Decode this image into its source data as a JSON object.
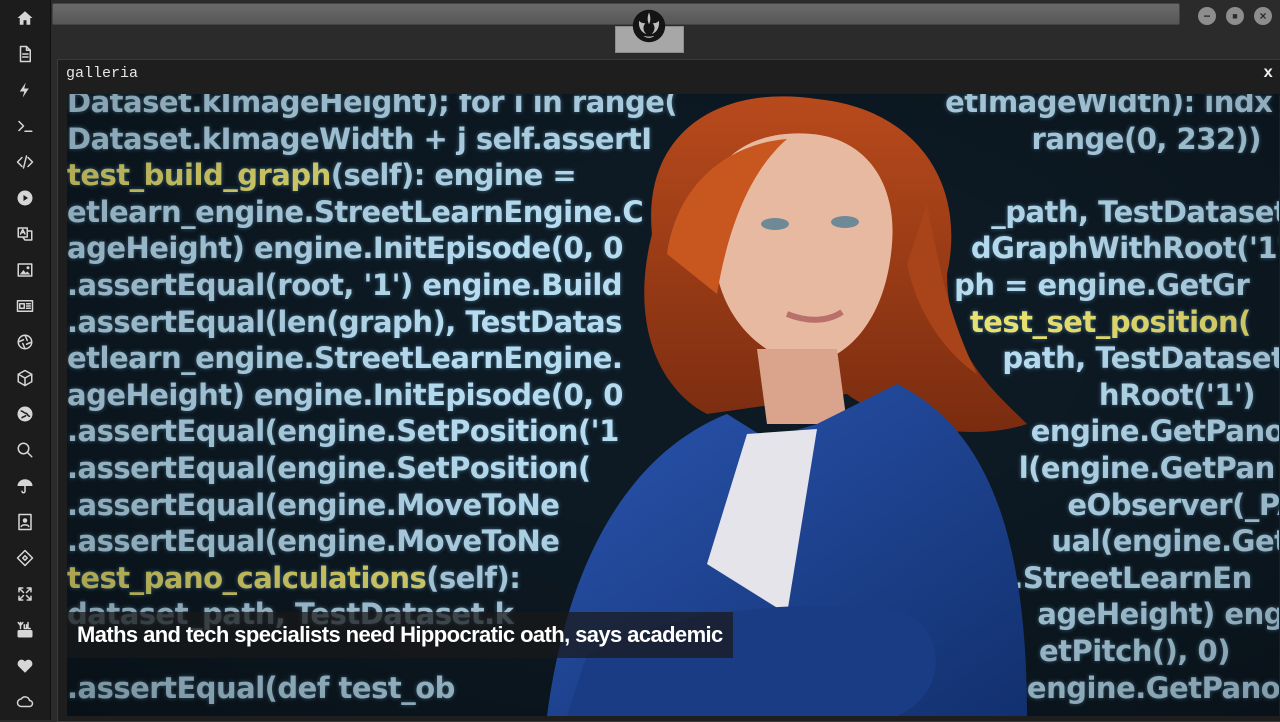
{
  "sidebar": {
    "icons": [
      "home-icon",
      "document-icon",
      "bolt-icon",
      "terminal-icon",
      "code-icon",
      "play-icon",
      "translate-icon",
      "image-icon",
      "news-icon",
      "aperture-icon",
      "hexagon-icon",
      "globe-icon",
      "search-icon",
      "umbrella-icon",
      "contact-card-icon",
      "git-diff-icon",
      "expand-icon",
      "youtube-icon",
      "heart-icon",
      "cloud-icon"
    ]
  },
  "window": {
    "logo": "rebel-alliance-logo",
    "controls": [
      "minimize",
      "maximize",
      "close"
    ]
  },
  "panel": {
    "title": "galleria",
    "close_label": "x"
  },
  "gallery": {
    "caption": "Maths and tech specialists need Hippocratic oath, says academic",
    "code_lines": [
      [
        "Dataset.kImageHeight); for i in range(",
        "",
        "etImageWidth): indx"
      ],
      [
        "Dataset.kImageWidth + j self.assertI",
        "",
        "range(0, 232))"
      ],
      [
        "test_build_graph",
        "(self): engine =",
        ""
      ],
      [
        "etlearn_engine.StreetLearnEngine.C",
        "",
        "_path, TestDataset"
      ],
      [
        "ageHeight) engine.InitEpisode(0, 0",
        "",
        "dGraphWithRoot('1'"
      ],
      [
        ".assertEqual(root, '1') engine.Build",
        "",
        "ph = engine.GetGr"
      ],
      [
        ".assertEqual(len(graph), TestDatas",
        "",
        "test_set_position("
      ],
      [
        "etlearn_engine.StreetLearnEngine.",
        "",
        "path, TestDataset"
      ],
      [
        "ageHeight) engine.InitEpisode(0, 0",
        "",
        "hRoot('1')"
      ],
      [
        ".assertEqual(engine.SetPosition('1",
        "",
        "engine.GetPano"
      ],
      [
        ".assertEqual(engine.SetPosition(",
        "",
        "l(engine.GetPan"
      ],
      [
        ".assertEqual(engine.MoveToNe",
        "",
        "eObserver(_PAN"
      ],
      [
        ".assertEqual(engine.MoveToNe",
        "",
        "ual(engine.GetP"
      ],
      [
        "test_pano_calculations",
        "(self):",
        ".StreetLearnEn"
      ],
      [
        "dataset_path, TestDataset.k",
        "",
        "ageHeight) eng"
      ],
      [
        "",
        "",
        "etPitch(), 0)"
      ],
      [
        ".assertEqual(def test_ob",
        "",
        "engine.GetPano"
      ]
    ]
  },
  "colors": {
    "rail": "#1c1c1c",
    "panel": "#1e1e1e",
    "code_blue": "#b7dcf0",
    "code_yellow": "#e8e070",
    "blazer": "#1d3f8a",
    "hair": "#c2541f"
  }
}
